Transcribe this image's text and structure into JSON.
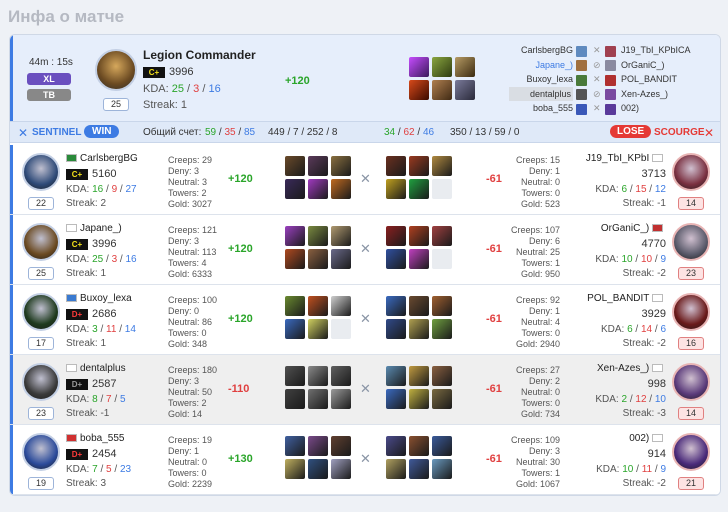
{
  "page_title": "Инфа о матче",
  "summary": {
    "duration": "44m : 15s",
    "tag_xl": "XL",
    "tag_tb": "TB",
    "hero_level": "25",
    "player_name": "Legion Commander",
    "rank_badge": "C+",
    "mmr": "3996",
    "kda_label": "KDA:",
    "kills": "25",
    "deaths": "3",
    "assists": "16",
    "streak": "Streak: 1",
    "mmr_change": "+120"
  },
  "sidebar_players": {
    "left": [
      "CarlsbergBG",
      "Japane_)",
      "Buxoy_lexa",
      "dentalplus",
      "boba_555"
    ],
    "right": [
      "J19_TbI_KPbICA",
      "OrGaniC_)",
      "POL_BANDIT",
      "Xen-Azes_)",
      "002)"
    ]
  },
  "statbar": {
    "sentinel_label": "SENTINEL",
    "win_label": "WIN",
    "score_label": "Общий счет:",
    "s_kills": "59",
    "s_deaths": "35",
    "s_assists": "85",
    "s_other": "449 / 7 / 252 / 8",
    "d_kills": "34",
    "d_deaths": "62",
    "d_assists": "46",
    "d_other": "350 / 13 / 59 / 0",
    "lose_label": "LOSE",
    "scourge_label": "SCOURGE"
  },
  "rows": [
    {
      "left": {
        "name": "CarlsbergBG",
        "rank": "C+",
        "mmr": "5160",
        "k": "16",
        "d": "9",
        "a": "27",
        "streak": "Streak: 2",
        "level": "22",
        "creeps": "Creeps: 29",
        "deny": "Deny: 3",
        "neutral": "Neutral: 3",
        "towers": "Towers: 2",
        "gold": "Gold: 3027",
        "delta": "+120"
      },
      "right": {
        "name": "J19_TbI_KPbI",
        "rank": "",
        "mmr": "3713",
        "k": "6",
        "d": "15",
        "a": "12",
        "streak": "Streak: -1",
        "level": "14",
        "creeps": "Creeps: 15",
        "deny": "Deny: 1",
        "neutral": "Neutral: 0",
        "towers": "Towers: 0",
        "gold": "Gold: 523",
        "delta": "-61"
      }
    },
    {
      "left": {
        "name": "Japane_)",
        "rank": "C+",
        "mmr": "3996",
        "k": "25",
        "d": "3",
        "a": "16",
        "streak": "Streak: 1",
        "level": "25",
        "creeps": "Creeps: 121",
        "deny": "Deny: 3",
        "neutral": "Neutral: 113",
        "towers": "Towers: 4",
        "gold": "Gold: 6333",
        "delta": "+120"
      },
      "right": {
        "name": "OrGaniC_)",
        "rank": "",
        "mmr": "4770",
        "k": "10",
        "d": "10",
        "a": "9",
        "streak": "Streak: -2",
        "level": "23",
        "creeps": "Creeps: 107",
        "deny": "Deny: 6",
        "neutral": "Neutral: 25",
        "towers": "Towers: 1",
        "gold": "Gold: 950",
        "delta": "-61"
      }
    },
    {
      "left": {
        "name": "Buxoy_lexa",
        "rank": "D+",
        "mmr": "2686",
        "k": "3",
        "d": "11",
        "a": "14",
        "streak": "Streak: 1",
        "level": "17",
        "creeps": "Creeps: 100",
        "deny": "Deny: 0",
        "neutral": "Neutral: 86",
        "towers": "Towers: 0",
        "gold": "Gold: 348",
        "delta": "+120"
      },
      "right": {
        "name": "POL_BANDIT",
        "rank": "",
        "mmr": "3929",
        "k": "6",
        "d": "14",
        "a": "6",
        "streak": "Streak: -2",
        "level": "16",
        "creeps": "Creeps: 92",
        "deny": "Deny: 1",
        "neutral": "Neutral: 4",
        "towers": "Towers: 0",
        "gold": "Gold: 2940",
        "delta": "-61"
      }
    },
    {
      "left": {
        "name": "dentalplus",
        "rank": "D+",
        "mmr": "2587",
        "k": "8",
        "d": "7",
        "a": "5",
        "streak": "Streak: -1",
        "level": "23",
        "creeps": "Creeps: 180",
        "deny": "Deny: 3",
        "neutral": "Neutral: 50",
        "towers": "Towers: 2",
        "gold": "Gold: 14",
        "delta": "-110"
      },
      "right": {
        "name": "Xen-Azes_)",
        "rank": "",
        "mmr": "998",
        "k": "2",
        "d": "12",
        "a": "10",
        "streak": "Streak: -3",
        "level": "14",
        "creeps": "Creeps: 27",
        "deny": "Deny: 2",
        "neutral": "Neutral: 0",
        "towers": "Towers: 0",
        "gold": "Gold: 734",
        "delta": "-61"
      }
    },
    {
      "left": {
        "name": "boba_555",
        "rank": "D+",
        "mmr": "2454",
        "k": "7",
        "d": "5",
        "a": "23",
        "streak": "Streak: 3",
        "level": "19",
        "creeps": "Creeps: 19",
        "deny": "Deny: 1",
        "neutral": "Neutral: 0",
        "towers": "Towers: 0",
        "gold": "Gold: 2239",
        "delta": "+130"
      },
      "right": {
        "name": "002)",
        "rank": "",
        "mmr": "914",
        "k": "10",
        "d": "11",
        "a": "9",
        "streak": "Streak: -2",
        "level": "21",
        "creeps": "Creeps: 109",
        "deny": "Deny: 3",
        "neutral": "Neutral: 30",
        "towers": "Towers: 1",
        "gold": "Gold: 1067",
        "delta": "-61"
      }
    }
  ],
  "colors": {
    "accent": "#3d7be3",
    "win": "#3d7be3",
    "lose": "#e53935",
    "positive": "#2aa52a",
    "negative": "#e04040"
  }
}
